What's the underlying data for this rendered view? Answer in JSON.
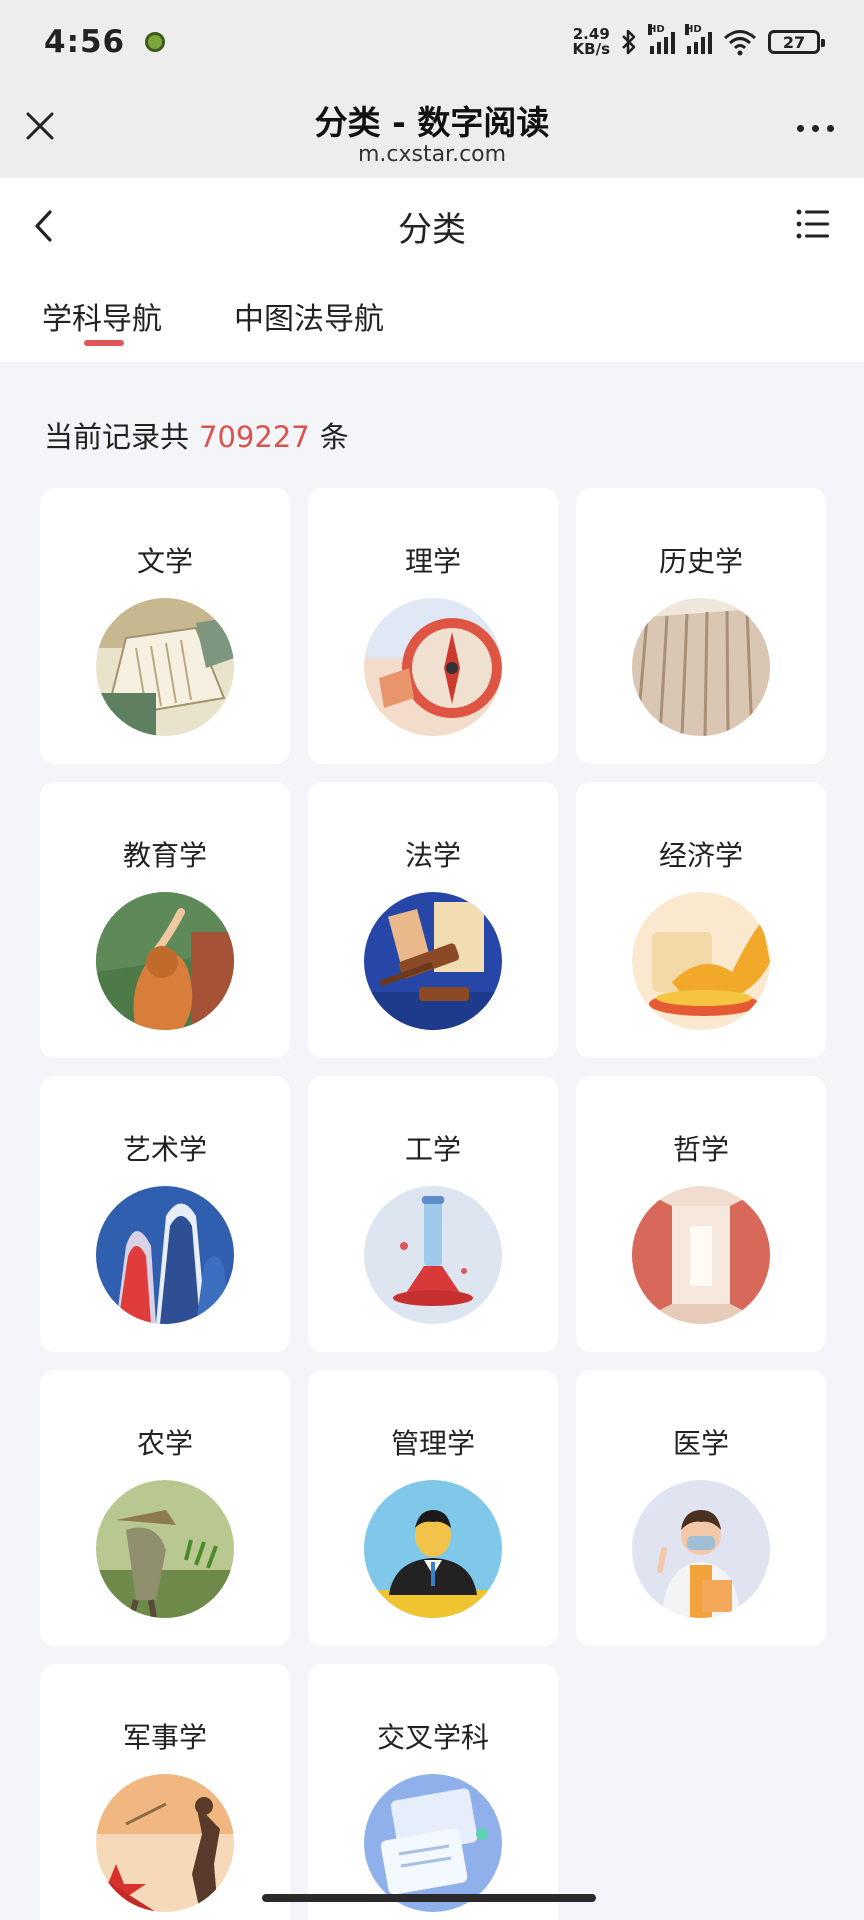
{
  "status": {
    "time": "4:56",
    "speed_value": "2.49",
    "speed_unit": "KB/s",
    "sim1_label": "HD",
    "sim2_label": "HD",
    "battery": "27"
  },
  "browser": {
    "title": "分类 - 数字阅读",
    "url": "m.cxstar.com"
  },
  "appnav": {
    "title": "分类"
  },
  "tabs": [
    {
      "label": "学科导航",
      "active": true
    },
    {
      "label": "中图法导航",
      "active": false
    }
  ],
  "count": {
    "prefix": "当前记录共",
    "value": "709227",
    "suffix": "条"
  },
  "categories": [
    {
      "label": "文学",
      "icon": "book-icon"
    },
    {
      "label": "理学",
      "icon": "compass-icon"
    },
    {
      "label": "历史学",
      "icon": "bamboo-slips-icon"
    },
    {
      "label": "教育学",
      "icon": "teacher-icon"
    },
    {
      "label": "法学",
      "icon": "gavel-icon"
    },
    {
      "label": "经济学",
      "icon": "gold-ingot-icon"
    },
    {
      "label": "艺术学",
      "icon": "art-shapes-icon"
    },
    {
      "label": "工学",
      "icon": "flask-icon"
    },
    {
      "label": "哲学",
      "icon": "corridor-icon"
    },
    {
      "label": "农学",
      "icon": "farmer-icon"
    },
    {
      "label": "管理学",
      "icon": "manager-icon"
    },
    {
      "label": "医学",
      "icon": "doctor-icon"
    },
    {
      "label": "军事学",
      "icon": "military-star-icon"
    },
    {
      "label": "交叉学科",
      "icon": "documents-icon"
    }
  ],
  "colors": {
    "accent": "#e05556",
    "count_number": "#d9534f",
    "background": "#f4f5f8"
  }
}
